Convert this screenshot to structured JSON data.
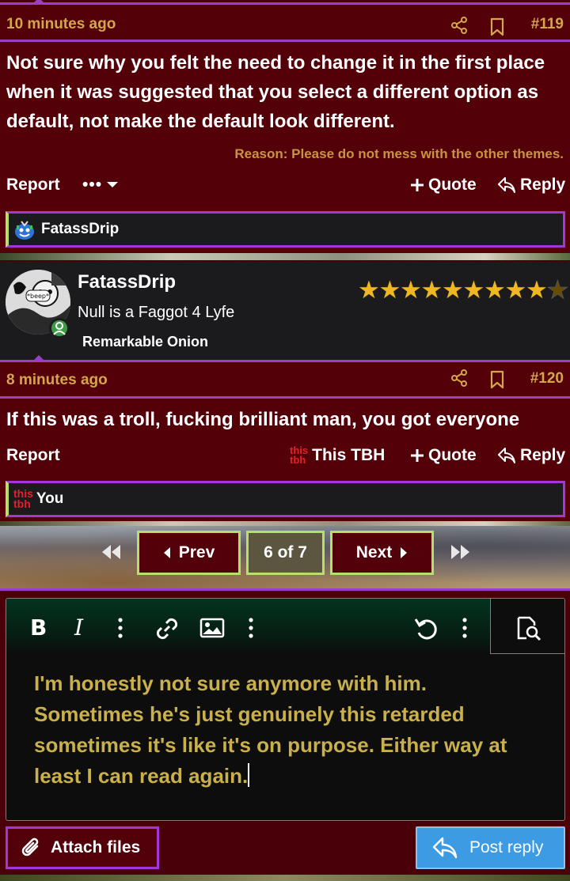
{
  "post119": {
    "time": "10 minutes ago",
    "number": "#119",
    "body": "Not sure why you felt the need to change it in the first place when it was suggested that you select a different option as default, not make the default look different.",
    "reason": "Reason: Please do not mess with the other themes.",
    "actions": {
      "report": "Report",
      "more": "•••",
      "quote": "Quote",
      "reply": "Reply"
    },
    "likes": {
      "name": "FatassDrip",
      "icon": "smiley-reaction-icon"
    }
  },
  "user": {
    "name": "FatassDrip",
    "title": "Null is a Faggot 4 Lyfe",
    "rank": "Remarkable Onion",
    "avatar_label": "*beep*",
    "stars_filled": 9,
    "stars_total": 10
  },
  "post120": {
    "time": "8 minutes ago",
    "number": "#120",
    "body": "If this was a troll, fucking brilliant man, you got everyone",
    "actions": {
      "report": "Report",
      "reaction_top": "this",
      "reaction_bottom": "tbh",
      "reaction_label": "This TBH",
      "quote": "Quote",
      "reply": "Reply"
    },
    "likes": {
      "icon_top": "this",
      "icon_bottom": "tbh",
      "name": "You"
    }
  },
  "pager": {
    "prev": "Prev",
    "current": "6 of 7",
    "next": "Next"
  },
  "editor": {
    "text": "I'm honestly not sure anymore with him. Sometimes he's just genuinely this retarded sometimes it's like it's on purpose. Either way at least I can read again."
  },
  "buttons": {
    "attach": "Attach files",
    "post_reply": "Post reply"
  },
  "colors": {
    "post_bg": "#540009",
    "accent_purple": "#9b3fc8",
    "accent_green": "#b5e06b",
    "meta_gold": "#d4a64a",
    "editor_text": "#c9b04b",
    "post_reply_bg": "#3c9be2"
  }
}
